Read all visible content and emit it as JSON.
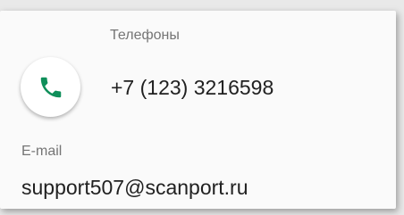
{
  "phones": {
    "label": "Телефоны",
    "number": "+7 (123) 3216598",
    "icon": "phone-icon",
    "icon_color": "#0f8f5a"
  },
  "email": {
    "label": "E-mail",
    "value": "support507@scanport.ru"
  }
}
